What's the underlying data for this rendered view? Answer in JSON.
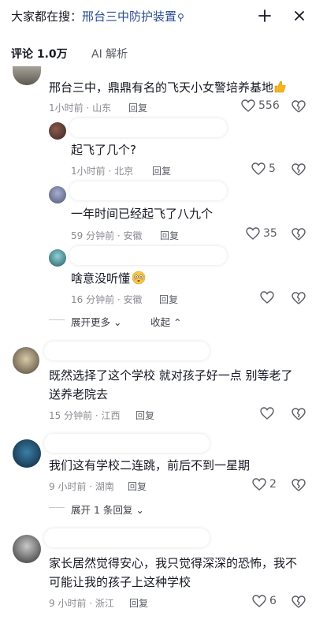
{
  "header": {
    "search_prefix": "大家都在搜：",
    "search_keyword": "邢台三中防护装置",
    "search_glyph": "⚲"
  },
  "tabs": [
    {
      "label": "评论 1.0万"
    },
    {
      "label": "AI 解析"
    }
  ],
  "comments": [
    {
      "text": "邢台三中，鼎鼎有名的飞天小女警培养基地",
      "meta": "1小时前 · 山东",
      "reply": "回复",
      "likes": "556"
    },
    {
      "text": "起飞了几个?",
      "meta": "1小时前 · 北京",
      "reply": "回复",
      "likes": "5"
    },
    {
      "text": "一年时间已经起飞了八九个",
      "meta": "59 分钟前 · 安徽",
      "reply": "回复",
      "likes": "35"
    },
    {
      "text": "啥意没听懂",
      "meta": "16 分钟前 · 安徽",
      "reply": "回复",
      "likes": ""
    },
    {
      "text": "既然选择了这个学校 就对孩子好一点 别等老了",
      "text2": "送养老院去",
      "meta": "15 分钟前 · 江西",
      "reply": "回复",
      "likes": ""
    },
    {
      "text": "我们这有学校二连跳，前后不到一星期",
      "meta": "9 小时前 · 湖南",
      "reply": "回复",
      "likes": "2"
    },
    {
      "text": "家长居然觉得安心，我只觉得深深的恐怖，我不",
      "text2": "可能让我的孩子上这种学校",
      "meta": "9 小时前 · 浙江",
      "reply": "回复",
      "likes": "6"
    }
  ],
  "thread": {
    "expand_more": "展开更多",
    "collapse": "收起",
    "expand_replies": "展开 1 条回复"
  },
  "colors": {
    "keyword": "#2a4d8f",
    "meta": "#8a8b91"
  }
}
